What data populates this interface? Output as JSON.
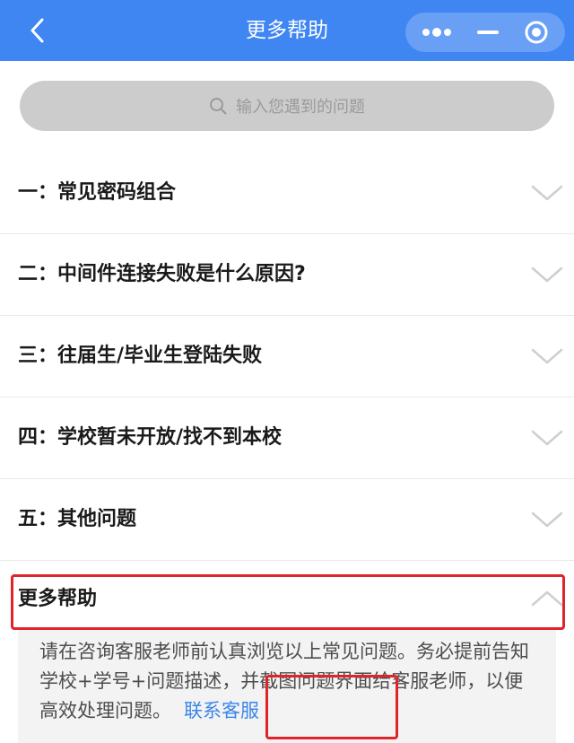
{
  "nav": {
    "title": "更多帮助",
    "back_icon": "chevron-left-icon",
    "more_icon": "more-dots-icon",
    "minimize_icon": "minus-icon",
    "close_icon": "target-circle-icon",
    "background_color": "#3f86f2"
  },
  "search": {
    "placeholder": "输入您遇到的问题"
  },
  "faq": [
    {
      "label": "一：常见密码组合"
    },
    {
      "label": "二：中间件连接失败是什么原因?"
    },
    {
      "label": "三：往届生/毕业生登陆失败"
    },
    {
      "label": "四：学校暂未开放/找不到本校"
    },
    {
      "label": "五：其他问题"
    }
  ],
  "expanded": {
    "title": "更多帮助",
    "answer": "请在咨询客服老师前认真浏览以上常见问题。务必提前告知学校+学号+问题描述，并截图问题界面给客服老师，以便高效处理问题。",
    "contact_link": "联系客服",
    "highlight_color": "#e0242b",
    "link_color": "#3a86ea"
  }
}
